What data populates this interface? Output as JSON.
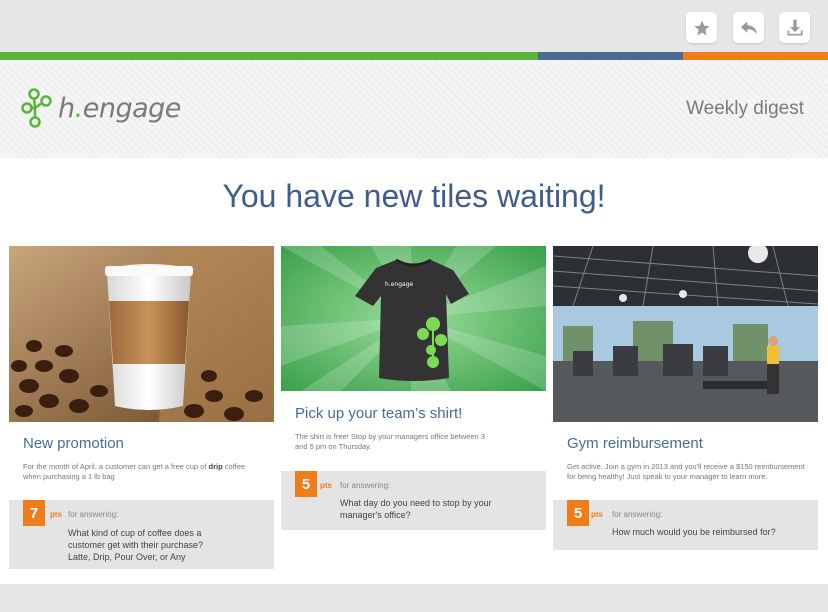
{
  "toolbar": {
    "star": "star-icon",
    "reply": "reply-icon",
    "download": "download-icon"
  },
  "colors": {
    "green": "#59b53a",
    "blue": "#4b6b96",
    "orange": "#f07c1a",
    "headline": "#3f5c8a"
  },
  "brand": {
    "name_h": "h",
    "name_dot": ".",
    "name_rest": "engage"
  },
  "header": {
    "digest_label": "Weekly digest"
  },
  "headline": "You have new tiles waiting!",
  "tiles": [
    {
      "title": "New promotion",
      "desc_pre": "For the month of April, a customer can get a free cup of ",
      "desc_bold": "drip",
      "desc_post": " coffee when purchasing a 1 lb bag",
      "pts": "7",
      "pts_label": "pts",
      "for_answering": "for answering:",
      "question": "What kind of cup of coffee does a customer get with their purchase?",
      "options": "Latte, Drip, Pour Over, or Any"
    },
    {
      "title": "Pick up your team’s shirt!",
      "desc": "The shirt is free! Stop by your managers office between 3 and 5 pm on Thursday.",
      "shirt_text": "h.engage",
      "pts": "5",
      "pts_label": "pts",
      "for_answering": "for answering:",
      "question": "What day do you need to stop by your manager's office?"
    },
    {
      "title": "Gym reimbursement",
      "desc": "Get active. Join a gym in 2013 and you'll receive a $150 reimbursement for being healthy! Just speak to your manager to learn more.",
      "pts": "5",
      "pts_label": "pts",
      "for_answering": "for answering:",
      "question": "How much would you be reimbursed for?"
    }
  ]
}
